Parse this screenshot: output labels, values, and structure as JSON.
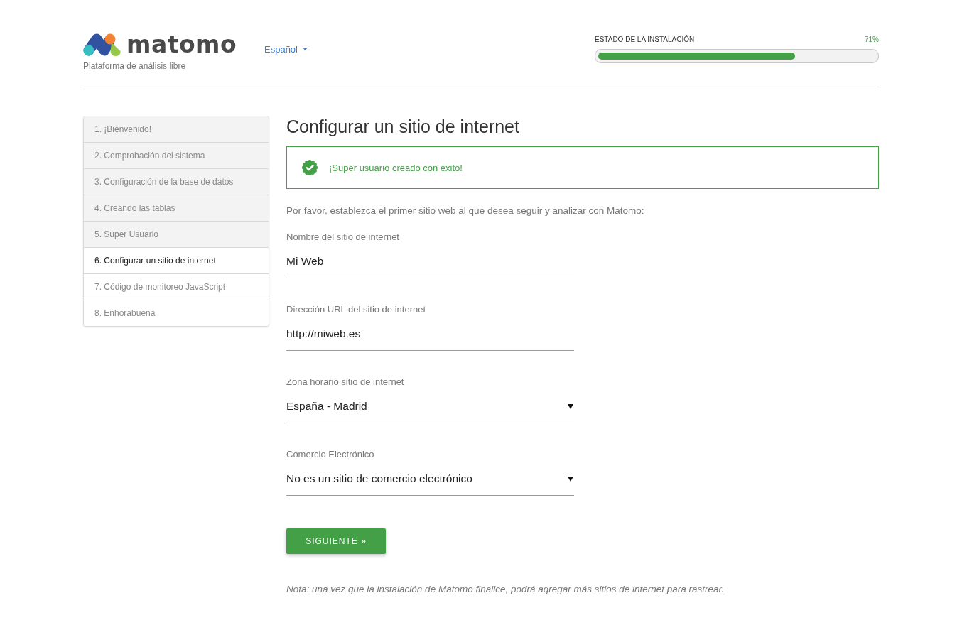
{
  "header": {
    "logo": {
      "wordmark": "matomo",
      "tagline": "Plataforma de análisis libre"
    },
    "language": {
      "label": "Español"
    },
    "progress": {
      "label": "ESTADO DE LA INSTALACIÓN",
      "reading": "71%",
      "level": 0.71
    }
  },
  "steps": [
    {
      "label": "1. ¡Bienvenido!",
      "completed": true,
      "selected": false
    },
    {
      "label": "2. Comprobación del sistema",
      "completed": true,
      "selected": false
    },
    {
      "label": "3. Configuración de la base de datos",
      "completed": true,
      "selected": false
    },
    {
      "label": "4. Creando las tablas",
      "completed": true,
      "selected": false
    },
    {
      "label": "5. Super Usuario",
      "completed": true,
      "selected": false
    },
    {
      "label": "6. Configurar un sitio de internet",
      "completed": false,
      "selected": true
    },
    {
      "label": "7. Código de monitoreo JavaScript",
      "completed": false,
      "selected": false
    },
    {
      "label": "8. Enhorabuena",
      "completed": false,
      "selected": false
    }
  ],
  "page": {
    "title": "Configurar un sitio de internet",
    "notice": {
      "kind": "success",
      "text": "¡Super usuario creado con éxito!"
    },
    "intro": "Por favor, establezca el primer sitio web al que desea seguir y analizar con Matomo:",
    "fields": [
      {
        "kind": "text",
        "label": "Nombre del sitio de internet",
        "value": "Mi Web"
      },
      {
        "kind": "text",
        "label": "Dirección URL del sitio de internet",
        "value": "http://miweb.es"
      },
      {
        "kind": "select",
        "label": "Zona horario sitio de internet",
        "value": "España - Madrid"
      },
      {
        "kind": "select",
        "label": "Comercio Electrónico",
        "value": "No es un sitio de comercio electrónico"
      }
    ],
    "submit": "SIGUIENTE »",
    "note": "Nota: una vez que la instalación de Matomo finalice, podrá agregar más sitios de internet para rastrear."
  }
}
